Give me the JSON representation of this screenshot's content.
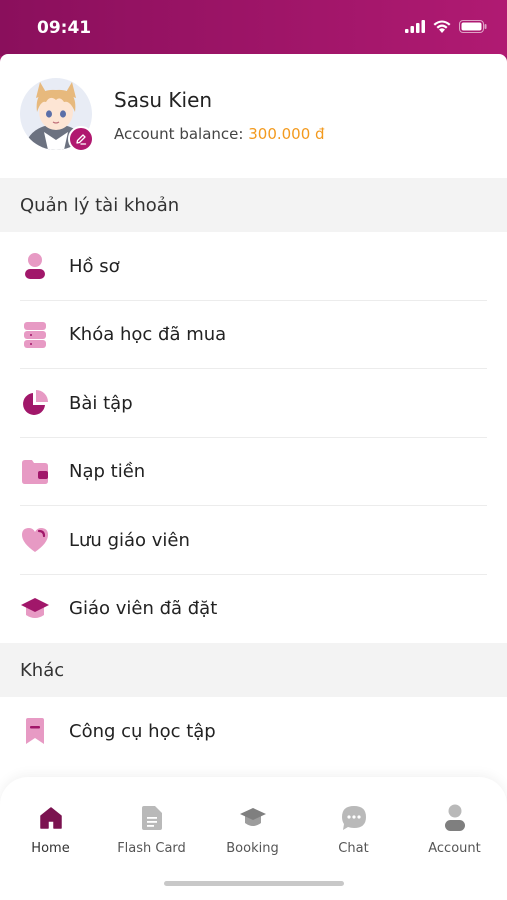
{
  "status": {
    "time": "09:41"
  },
  "profile": {
    "name": "Sasu Kien",
    "balance_label": "Account balance:",
    "balance_value": "300.000 đ"
  },
  "sections": {
    "account": {
      "title": "Quản lý tài khoản",
      "items": [
        {
          "label": "Hồ sơ",
          "icon": "person-icon"
        },
        {
          "label": "Khóa học đã mua",
          "icon": "course-stack-icon"
        },
        {
          "label": "Bài tập",
          "icon": "pie-chart-icon"
        },
        {
          "label": "Nạp tiền",
          "icon": "wallet-icon"
        },
        {
          "label": "Lưu giáo viên",
          "icon": "heart-icon"
        },
        {
          "label": "Giáo viên đã đặt",
          "icon": "graduation-cap-icon"
        }
      ]
    },
    "other": {
      "title": "Khác",
      "items": [
        {
          "label": "Công cụ học tập",
          "icon": "bookmark-icon"
        }
      ]
    }
  },
  "tabbar": {
    "tabs": [
      {
        "label": "Home",
        "icon": "home-icon",
        "active": true
      },
      {
        "label": "Flash Card",
        "icon": "document-icon",
        "active": false
      },
      {
        "label": "Booking",
        "icon": "graduation-cap-icon",
        "active": false
      },
      {
        "label": "Chat",
        "icon": "chat-icon",
        "active": false
      },
      {
        "label": "Account",
        "icon": "person-icon",
        "active": false
      }
    ]
  },
  "colors": {
    "brand": "#a1176a",
    "icon_light": "#e79ac4",
    "balance": "#f39a1e"
  }
}
